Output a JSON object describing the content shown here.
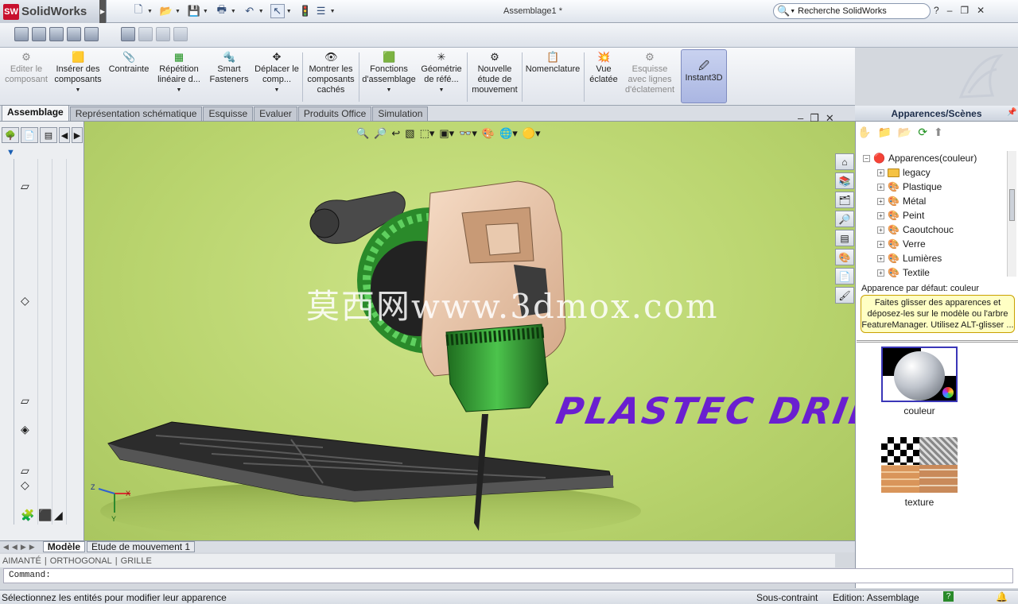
{
  "app": {
    "name": "SolidWorks",
    "logo": "SW",
    "document_title": "Assemblage1 *",
    "search_placeholder": "Recherche SolidWorks",
    "window_buttons": [
      "?",
      "–",
      "❐",
      "✕"
    ]
  },
  "command_manager": [
    {
      "label": "Editer le composant",
      "icon": "edit-component-icon",
      "disabled": true
    },
    {
      "label": "Insérer des composants",
      "icon": "insert-components-icon"
    },
    {
      "label": "Contrainte",
      "icon": "mate-icon"
    },
    {
      "label": "Répétition linéaire d...",
      "icon": "linear-pattern-icon"
    },
    {
      "label": "Smart Fasteners",
      "icon": "smart-fasteners-icon"
    },
    {
      "label": "Déplacer le comp...",
      "icon": "move-component-icon"
    },
    {
      "label": "Montrer les composants cachés",
      "icon": "show-hidden-icon"
    },
    {
      "label": "Fonctions d'assemblage",
      "icon": "assembly-features-icon"
    },
    {
      "label": "Géométrie de réfé...",
      "icon": "reference-geometry-icon"
    },
    {
      "label": "Nouvelle étude de mouvement",
      "icon": "motion-study-icon"
    },
    {
      "label": "Nomenclature",
      "icon": "bom-icon"
    },
    {
      "label": "Vue éclatée",
      "icon": "exploded-view-icon"
    },
    {
      "label": "Esquisse avec lignes d'éclatement",
      "icon": "explode-line-icon",
      "disabled": true
    },
    {
      "label": "Instant3D",
      "icon": "instant3d-icon",
      "active": true
    }
  ],
  "tabs": [
    "Assemblage",
    "Représentation schématique",
    "Esquisse",
    "Evaluer",
    "Produits Office",
    "Simulation"
  ],
  "active_tab": "Assemblage",
  "viewport": {
    "watermark": "莫西网www.3dmox.com",
    "model_label": "PLASTEC DRILL",
    "background": "#b9d46e",
    "triad": {
      "x": "X",
      "y": "Y",
      "z": "Z"
    }
  },
  "task_pane": {
    "title": "Apparences/Scènes",
    "tree_root": "Apparences(couleur)",
    "tree_items": [
      "legacy",
      "Plastique",
      "Métal",
      "Peint",
      "Caoutchouc",
      "Verre",
      "Lumières",
      "Textile"
    ],
    "default_label": "Apparence par défaut: couleur",
    "tooltip": "Faites glisser des apparences et déposez-les sur le modèle ou l'arbre FeatureManager. Utilisez ALT-glisser ...",
    "thumbnails": [
      {
        "label": "couleur"
      },
      {
        "label": "texture"
      }
    ]
  },
  "bottom_tabs": [
    "Modèle",
    "Etude de mouvement 1"
  ],
  "snap_items": [
    "AIMANTÉ",
    "ORTHOGONAL",
    "GRILLE"
  ],
  "command_line": "Command:",
  "status": {
    "message": "Sélectionnez les entités pour modifier leur apparence",
    "constraint": "Sous-contraint",
    "edition": "Edition: Assemblage"
  },
  "colors": {
    "accent": "#3a36b8",
    "viewport_bg": "#b9d46e",
    "model_label": "#6a1fd0",
    "logo_red": "#c8102e"
  }
}
